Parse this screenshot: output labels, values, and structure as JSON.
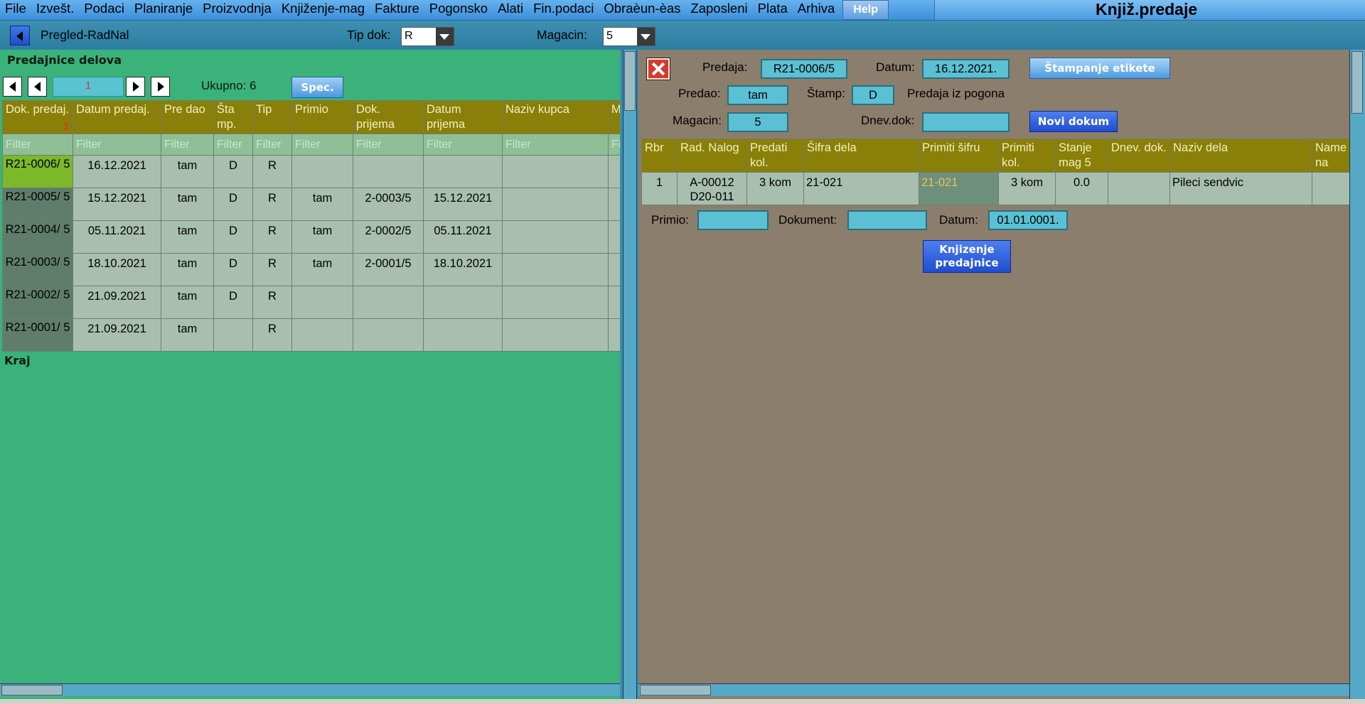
{
  "menu": {
    "items": [
      "File",
      "Izvešt.",
      "Podaci",
      "Planiranje",
      "Proizvodnja",
      "Knjiženje-mag",
      "Fakture",
      "Pogonsko",
      "Alati",
      "Fin.podaci",
      "Obraèun-èas",
      "Zaposleni",
      "Plata",
      "Arhiva"
    ],
    "help": "Help",
    "app_title": "Knjiž.predaje"
  },
  "toolbar": {
    "nav_label": "Pregled-RadNal",
    "tip_dok_label": "Tip dok:",
    "tip_dok_value": "R",
    "magacin_label": "Magacin:",
    "magacin_value": "5"
  },
  "left": {
    "title": "Predajnice delova",
    "page": "1",
    "ukupno": "Ukupno: 6",
    "spec": "Spec.",
    "sort_indicator": "1",
    "columns": [
      "Dok. predaj.",
      "Datum predaj.",
      "Pre dao",
      "Šta mp.",
      "Tip",
      "Primio",
      "Dok. prijema",
      "Datum prijema",
      "Naziv kupca",
      "M"
    ],
    "filter": "Filter",
    "rows": [
      {
        "dok": "R21-0006/ 5",
        "datum": "16.12.2021",
        "predao": "tam",
        "stamp": "D",
        "tip": "R",
        "primio": "",
        "dok_prijema": "",
        "datum_prijema": "",
        "kupac": ""
      },
      {
        "dok": "R21-0005/ 5",
        "datum": "15.12.2021",
        "predao": "tam",
        "stamp": "D",
        "tip": "R",
        "primio": "tam",
        "dok_prijema": "2-0003/5",
        "datum_prijema": "15.12.2021",
        "kupac": ""
      },
      {
        "dok": "R21-0004/ 5",
        "datum": "05.11.2021",
        "predao": "tam",
        "stamp": "D",
        "tip": "R",
        "primio": "tam",
        "dok_prijema": "2-0002/5",
        "datum_prijema": "05.11.2021",
        "kupac": ""
      },
      {
        "dok": "R21-0003/ 5",
        "datum": "18.10.2021",
        "predao": "tam",
        "stamp": "D",
        "tip": "R",
        "primio": "tam",
        "dok_prijema": "2-0001/5",
        "datum_prijema": "18.10.2021",
        "kupac": ""
      },
      {
        "dok": "R21-0002/ 5",
        "datum": "21.09.2021",
        "predao": "tam",
        "stamp": "D",
        "tip": "R",
        "primio": "",
        "dok_prijema": "",
        "datum_prijema": "",
        "kupac": ""
      },
      {
        "dok": "R21-0001/ 5",
        "datum": "21.09.2021",
        "predao": "tam",
        "stamp": "",
        "tip": "R",
        "primio": "",
        "dok_prijema": "",
        "datum_prijema": "",
        "kupac": ""
      }
    ],
    "end_label": "Kraj"
  },
  "right": {
    "predaja_label": "Predaja:",
    "predaja_value": "R21-0006/5",
    "datum_label": "Datum:",
    "datum_value": "16.12.2021.",
    "stampanje_btn": "Štampanje etikete",
    "predao_label": "Predao:",
    "predao_value": "tam",
    "stamp_label": "Štamp:",
    "stamp_value": "D",
    "predaja_iz_pogona": "Predaja iz pogona",
    "magacin_label": "Magacin:",
    "magacin_value": "5",
    "dnevdok_label": "Dnev.dok:",
    "dnevdok_value": "",
    "novi_dokum_btn": "Novi dokum",
    "columns": [
      "Rbr",
      "Rad. Nalog",
      "Predati kol.",
      "Šifra dela",
      "Primiti šifru",
      "Primiti kol.",
      "Stanje mag 5",
      "Dnev. dok.",
      "Naziv dela",
      "Name na"
    ],
    "rows": [
      {
        "rbr": "1",
        "nalog": "A-00012 D20-011",
        "predati": "3 kom",
        "sifra": "21-021",
        "primiti_sifru": "21-021",
        "primiti_kol": "3 kom",
        "stanje": "0.0",
        "dnev": "",
        "naziv": "Pileci sendvic",
        "name": ""
      }
    ],
    "primio_label": "Primio:",
    "primio_value": "",
    "dokument_label": "Dokument:",
    "dokument_value": "",
    "datum2_label": "Datum:",
    "datum2_value": "01.01.0001.",
    "knjizenje_btn_line1": "Knjizenje",
    "knjizenje_btn_line2": "predajnice"
  }
}
